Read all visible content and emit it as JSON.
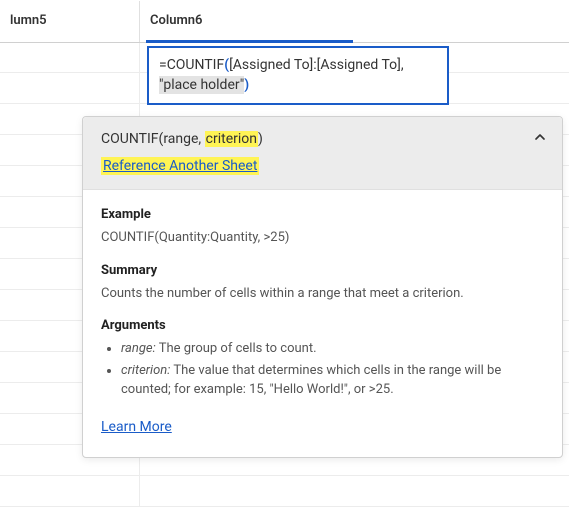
{
  "columns": {
    "col5": "lumn5",
    "col6": "Column6"
  },
  "formula": {
    "eq": "=",
    "fn": "COUNTIF",
    "open": "(",
    "ref": "[Assigned To]:[Assigned To]",
    "comma": ", ",
    "str": "\"place holder\"",
    "close": ")"
  },
  "tooltip": {
    "sig_fn": "COUNTIF",
    "sig_open": "(",
    "sig_range": "range",
    "sig_sep": ", ",
    "sig_criterion": "criterion",
    "sig_close": ")",
    "ref_link": "Reference Another Sheet",
    "example_head": "Example",
    "example_text": "COUNTIF(Quantity:Quantity, >25)",
    "summary_head": "Summary",
    "summary_text": "Counts the number of cells within a range that meet a criterion.",
    "arguments_head": "Arguments",
    "arg1_name": "range:",
    "arg1_text": " The group of cells to count.",
    "arg2_name": "criterion:",
    "arg2_text": " The value that determines which cells in the range will be counted; for example: 15, \"Hello World!\", or >25.",
    "learn_more": "Learn More"
  }
}
